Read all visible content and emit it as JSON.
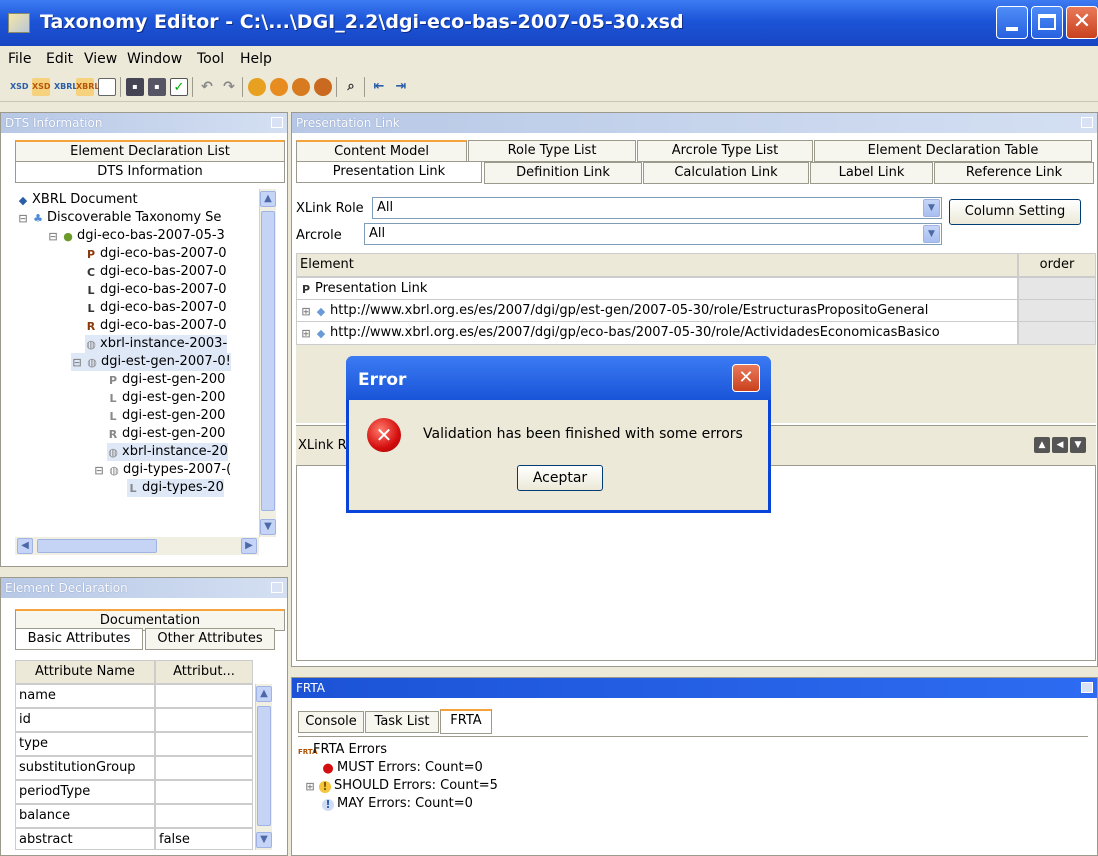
{
  "window": {
    "title": "Taxonomy Editor - C:\\...\\DGI_2.2\\dgi-eco-bas-2007-05-30.xsd"
  },
  "menu": [
    "File",
    "Edit",
    "View",
    "Window",
    "Tool",
    "Help"
  ],
  "toolbar_icons": [
    "xsd",
    "xsd",
    "xbrl",
    "xbrl",
    "window",
    "save",
    "save-all",
    "validate",
    "undo",
    "redo",
    "globe",
    "globe",
    "globe",
    "globe",
    "find",
    "export",
    "import"
  ],
  "dts_panel": {
    "title": "DTS Information",
    "tabs": [
      "Element Declaration List",
      "DTS Information"
    ],
    "tree": [
      {
        "label": "XBRL Document",
        "icon": "xbrl"
      },
      {
        "label": "Discoverable Taxonomy Se",
        "icon": "dts"
      },
      {
        "label": "dgi-eco-bas-2007-05-3",
        "icon": "schema"
      },
      {
        "label": "dgi-eco-bas-2007-0",
        "icon": "P"
      },
      {
        "label": "dgi-eco-bas-2007-0",
        "icon": "C"
      },
      {
        "label": "dgi-eco-bas-2007-0",
        "icon": "L"
      },
      {
        "label": "dgi-eco-bas-2007-0",
        "icon": "L"
      },
      {
        "label": "dgi-eco-bas-2007-0",
        "icon": "R"
      },
      {
        "label": "xbrl-instance-2003-",
        "icon": "schema"
      },
      {
        "label": "dgi-est-gen-2007-0!",
        "icon": "schema"
      },
      {
        "label": "dgi-est-gen-200",
        "icon": "P"
      },
      {
        "label": "dgi-est-gen-200",
        "icon": "L"
      },
      {
        "label": "dgi-est-gen-200",
        "icon": "L"
      },
      {
        "label": "dgi-est-gen-200",
        "icon": "R"
      },
      {
        "label": "xbrl-instance-20",
        "icon": "schema"
      },
      {
        "label": "dgi-types-2007-(",
        "icon": "schema"
      },
      {
        "label": "dgi-types-20",
        "icon": "L"
      }
    ]
  },
  "element_panel": {
    "title": "Element Declaration",
    "tabs": [
      "Documentation",
      "Basic Attributes",
      "Other Attributes"
    ],
    "columns": [
      "Attribute Name",
      "Attribut..."
    ],
    "rows": [
      {
        "name": "name",
        "value": ""
      },
      {
        "name": "id",
        "value": ""
      },
      {
        "name": "type",
        "value": ""
      },
      {
        "name": "substitutionGroup",
        "value": ""
      },
      {
        "name": "periodType",
        "value": ""
      },
      {
        "name": "balance",
        "value": ""
      },
      {
        "name": "abstract",
        "value": "false"
      }
    ]
  },
  "presentation_panel": {
    "title": "Presentation Link",
    "tabs_row1": [
      "Content Model",
      "Role Type List",
      "Arcrole Type List",
      "Element Declaration Table"
    ],
    "tabs_row2": [
      "Presentation Link",
      "Definition Link",
      "Calculation Link",
      "Label Link",
      "Reference Link"
    ],
    "xlink_role_label": "XLink Role",
    "xlink_role_value": "All",
    "arcrole_label": "Arcrole",
    "arcrole_value": "All",
    "column_setting": "Column Setting",
    "grid_columns": [
      "Element",
      "order"
    ],
    "grid_rows": [
      "Presentation Link",
      "http://www.xbrl.org.es/es/2007/dgi/gp/est-gen/2007-05-30/role/EstructurasPropositoGeneral",
      "http://www.xbrl.org.es/es/2007/dgi/gp/eco-bas/2007-05-30/role/ActividadesEconomicasBasico"
    ],
    "lower_label": "XLink R"
  },
  "frta_panel": {
    "title": "FRTA",
    "tabs": [
      "Console",
      "Task List",
      "FRTA"
    ],
    "tree": [
      {
        "label": "FRTA Errors"
      },
      {
        "label": "MUST Errors: Count=0"
      },
      {
        "label": "SHOULD Errors: Count=5"
      },
      {
        "label": "MAY Errors: Count=0"
      }
    ]
  },
  "dialog": {
    "title": "Error",
    "message": "Validation has been finished with some errors",
    "button": "Aceptar"
  },
  "colors": {
    "title_bar": "#1c55d8",
    "active_header": "#1c53d6",
    "inactive_header": "#b7c8e6",
    "tab_highlight": "#f6a33c",
    "error_red": "#d40e0e"
  }
}
